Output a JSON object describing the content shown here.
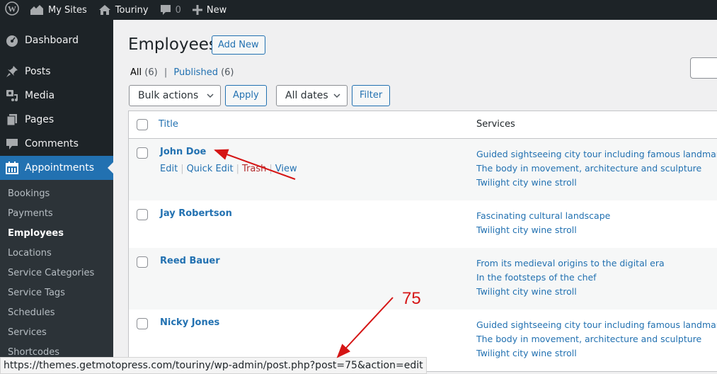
{
  "adminbar": {
    "wp_logo_icon": "wordpress-logo-icon",
    "my_sites": "My Sites",
    "site_name": "Touriny",
    "comments_count": "0",
    "new_label": "New"
  },
  "sidebar": {
    "items": [
      {
        "label": "Dashboard",
        "icon": "dashboard-icon"
      },
      {
        "label": "Posts",
        "icon": "pin-icon"
      },
      {
        "label": "Media",
        "icon": "media-icon"
      },
      {
        "label": "Pages",
        "icon": "pages-icon"
      },
      {
        "label": "Comments",
        "icon": "comment-icon"
      },
      {
        "label": "Appointments",
        "icon": "calendar-icon",
        "active": true
      }
    ],
    "submenu": [
      {
        "label": "Bookings"
      },
      {
        "label": "Payments"
      },
      {
        "label": "Employees",
        "current": true
      },
      {
        "label": "Locations"
      },
      {
        "label": "Service Categories"
      },
      {
        "label": "Service Tags"
      },
      {
        "label": "Schedules"
      },
      {
        "label": "Services"
      },
      {
        "label": "Shortcodes"
      }
    ]
  },
  "page": {
    "title": "Employees",
    "add_new": "Add New",
    "filters": {
      "all_label": "All",
      "all_count": "(6)",
      "separator": "|",
      "published_label": "Published",
      "published_count": "(6)"
    },
    "bulk_actions": "Bulk actions",
    "apply": "Apply",
    "all_dates": "All dates",
    "filter": "Filter"
  },
  "table": {
    "columns": [
      "Title",
      "Services"
    ],
    "rows": [
      {
        "name": "John Doe",
        "services": [
          "Guided sightseeing city tour including famous landmarks",
          "The body in movement, architecture and sculpture",
          "Twilight city wine stroll"
        ],
        "actions": [
          "Edit",
          "Quick Edit",
          "Trash",
          "View"
        ]
      },
      {
        "name": "Jay Robertson",
        "services": [
          "Fascinating cultural landscape",
          "Twilight city wine stroll"
        ]
      },
      {
        "name": "Reed Bauer",
        "services": [
          "From its medieval origins to the digital era",
          "In the footsteps of the chef",
          "Twilight city wine stroll"
        ]
      },
      {
        "name": "Nicky Jones",
        "services": [
          "Guided sightseeing city tour including famous landmarks",
          "The body in movement, architecture and sculpture",
          "Twilight city wine stroll"
        ]
      }
    ]
  },
  "statusbar": {
    "url": "https://themes.getmotopress.com/touriny/wp-admin/post.php?post=75&action=edit"
  },
  "annotation": {
    "label": "75",
    "color": "#d51515"
  }
}
